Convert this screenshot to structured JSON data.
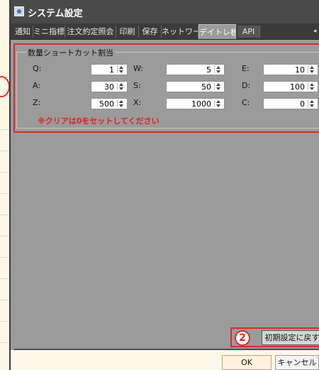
{
  "window": {
    "title": "システム設定"
  },
  "tabs": [
    {
      "label": "通知",
      "active": false
    },
    {
      "label": "ミニ指標",
      "active": false
    },
    {
      "label": "注文約定照会",
      "active": false
    },
    {
      "label": "印刷",
      "active": false
    },
    {
      "label": "保存",
      "active": false
    },
    {
      "label": "ネットワーク",
      "active": false
    },
    {
      "label": "デイトレ板",
      "active": true
    },
    {
      "label": "API",
      "active": false
    }
  ],
  "group": {
    "label": "数量ショートカット割当",
    "note": "※クリアは0をセットしてください",
    "fields": [
      {
        "key": "Q:",
        "value": "1"
      },
      {
        "key": "W:",
        "value": "5"
      },
      {
        "key": "E:",
        "value": "10"
      },
      {
        "key": "A:",
        "value": "30"
      },
      {
        "key": "S:",
        "value": "50"
      },
      {
        "key": "D:",
        "value": "100"
      },
      {
        "key": "Z:",
        "value": "500"
      },
      {
        "key": "X:",
        "value": "1000"
      },
      {
        "key": "C:",
        "value": "0"
      }
    ]
  },
  "footer": {
    "reset_label": "初期設定に戻す",
    "ok_label": "OK",
    "cancel_label": "キャンセル",
    "step_badge": "2"
  },
  "colors": {
    "highlight": "#d62c2c",
    "panel": "#9b9b9b",
    "titlebar": "#4a4a4a"
  }
}
